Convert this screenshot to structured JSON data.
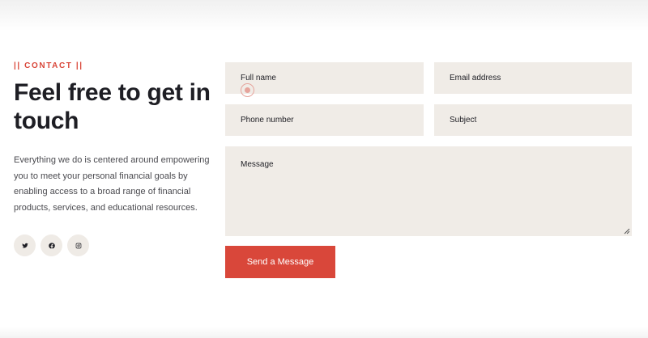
{
  "contact": {
    "eyebrow": "|| CONTACT ||",
    "title": "Feel free to get in touch",
    "description": "Everything we do is centered around empowering you to meet your personal financial goals by enabling access to a broad range of financial products, services, and educational resources.",
    "socials": [
      {
        "icon": "twitter-icon"
      },
      {
        "icon": "facebook-icon"
      },
      {
        "icon": "instagram-icon"
      }
    ]
  },
  "form": {
    "full_name": "Full name",
    "email": "Email address",
    "phone": "Phone number",
    "subject": "Subject",
    "message": "Message",
    "submit_label": "Send a Message"
  },
  "colors": {
    "accent": "#d9473a",
    "field_bg": "#f0ece7",
    "text": "#1e1e24"
  }
}
